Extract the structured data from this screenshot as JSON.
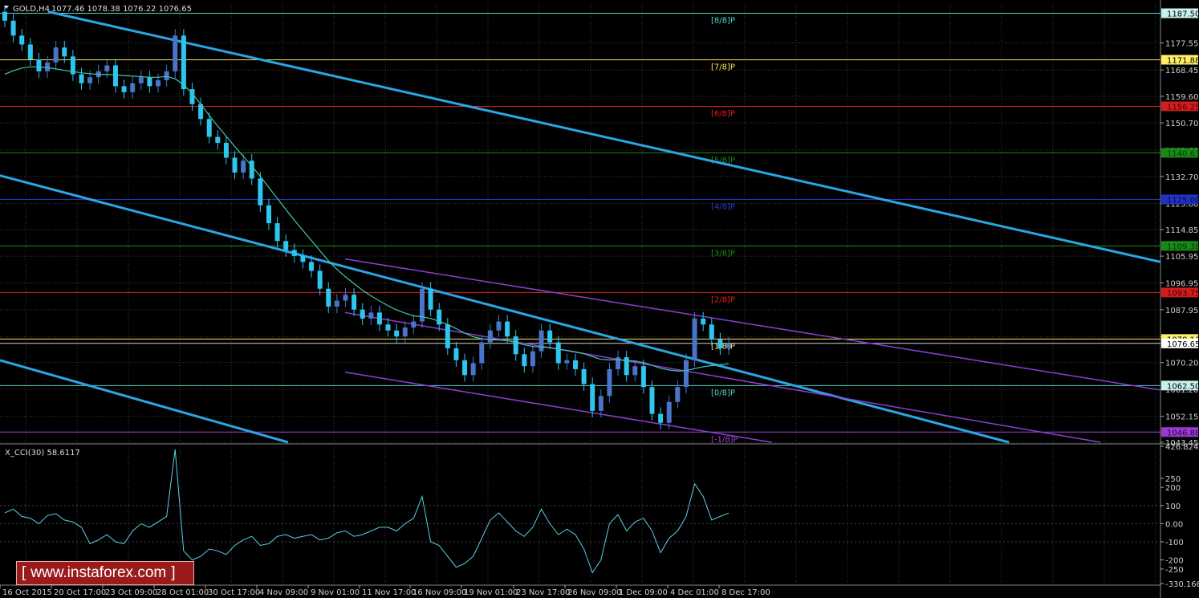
{
  "header": {
    "symbol_label": "GOLD,H4",
    "ohlc": "1077.46 1078.38 1076.22 1076.65"
  },
  "indicator": {
    "label": "X_CCI(30) 58.6117",
    "scale": {
      "max": 426.8245,
      "min": -330.1663
    },
    "ticks": [
      {
        "v": 426.8245,
        "label": "426.8245"
      },
      {
        "v": 250,
        "label": "250"
      },
      {
        "v": 200,
        "label": "200"
      },
      {
        "v": 100,
        "label": "100"
      },
      {
        "v": 0,
        "label": "0.00"
      },
      {
        "v": -100,
        "label": "-100"
      },
      {
        "v": -200,
        "label": "-200"
      },
      {
        "v": -250,
        "label": "-250"
      },
      {
        "v": -330.1663,
        "label": "-330.1663"
      }
    ]
  },
  "logo": {
    "left": "[",
    "text": "www.instaforex.com",
    "right": "]"
  },
  "colors": {
    "background": "#000000",
    "grid": "#3a3a3a",
    "up_candle": "#4a74c9",
    "down_candle": "#2ec5ee",
    "moving_average": "#3fc8b0",
    "trend_channel": "#2aa6e6",
    "regression_channel": "#8c3fd1",
    "cci_line": "#5cd0e6",
    "logo_bg": "#9b1b1b"
  },
  "chart_data": {
    "type": "line",
    "title": "GOLD,H4",
    "y_range": [
      1043.45,
      1190.6
    ],
    "y_ticks": [
      1177.55,
      1168.45,
      1159.6,
      1150.7,
      1141.6,
      1132.7,
      1123.6,
      1114.85,
      1105.95,
      1096.95,
      1087.95,
      1078.85,
      1070.2,
      1061.2,
      1052.15,
      1043.45
    ],
    "x_labels": [
      "16 Oct 2015",
      "20 Oct 17:00",
      "23 Oct 09:00",
      "28 Oct 01:00",
      "30 Oct 17:00",
      "4 Nov 09:00",
      "9 Nov 01:00",
      "11 Nov 17:00",
      "16 Nov 09:00",
      "19 Nov 01:00",
      "23 Nov 17:00",
      "26 Nov 09:00",
      "1 Dec 09:00",
      "4 Dec 01:00",
      "8 Dec 17:00"
    ],
    "murrey_levels": [
      {
        "label": "[8/8]P",
        "value": 1187.5,
        "price_tag": "1187.50",
        "color": "#4fd4c8",
        "tag_bg": "#c8f0ec",
        "tag_fg": "#000000"
      },
      {
        "label": "[7/8]P",
        "value": 1171.88,
        "price_tag": "1171.88",
        "color": "#ffe55c",
        "tag_bg": "#ffee66",
        "tag_fg": "#000000"
      },
      {
        "label": "[6/8]P",
        "value": 1156.25,
        "price_tag": "1156.25",
        "color": "#e02020",
        "tag_bg": "#d21d1d",
        "tag_fg": "#4a0000"
      },
      {
        "label": "[5/8]P",
        "value": 1140.63,
        "price_tag": "1140.63",
        "color": "#1f8a1f",
        "tag_bg": "#188a18",
        "tag_fg": "#003800"
      },
      {
        "label": "[4/8]P",
        "value": 1125.0,
        "price_tag": "1125.00",
        "color": "#2a3ccf",
        "tag_bg": "#2233c2",
        "tag_fg": "#000c50"
      },
      {
        "label": "[3/8]P",
        "value": 1109.38,
        "price_tag": "1109.38",
        "color": "#1f8a1f",
        "tag_bg": "#188a18",
        "tag_fg": "#003800"
      },
      {
        "label": "[2/8]P",
        "value": 1093.75,
        "price_tag": "1093.75",
        "color": "#e02020",
        "tag_bg": "#d21d1d",
        "tag_fg": "#4a0000"
      },
      {
        "label": "[1/8]P",
        "value": 1078.13,
        "price_tag": "1078.13",
        "color": "#ffe55c",
        "tag_bg": "#ffee66",
        "tag_fg": "#000000"
      },
      {
        "label": "[0/8]P",
        "value": 1062.5,
        "price_tag": "1062.50",
        "color": "#4fd4c8",
        "tag_bg": "#c8f0ec",
        "tag_fg": "#000000"
      },
      {
        "label": "[-1/8]P",
        "value": 1046.88,
        "price_tag": "1046.88",
        "color": "#a13fd6",
        "tag_bg": "#9a3bd0",
        "tag_fg": "#2a004a"
      }
    ],
    "current_price": 1076.65,
    "price_line_tag": "1076.65",
    "series": [
      {
        "type": "candlestick",
        "close": [
          1185,
          1180,
          1177,
          1172,
          1168,
          1171,
          1176,
          1173,
          1167,
          1164,
          1166,
          1168,
          1170,
          1163,
          1161,
          1164,
          1166,
          1163,
          1165,
          1168,
          1180,
          1162,
          1157,
          1152,
          1146,
          1144,
          1139,
          1134,
          1138,
          1132,
          1123,
          1117,
          1111,
          1108,
          1106,
          1104,
          1101,
          1095,
          1089,
          1091,
          1093,
          1088,
          1085,
          1087,
          1083,
          1081,
          1079,
          1082,
          1084,
          1095,
          1088,
          1083,
          1075,
          1071,
          1066,
          1070,
          1077,
          1081,
          1084,
          1079,
          1073,
          1069,
          1074,
          1081,
          1077,
          1070,
          1071,
          1068,
          1063,
          1054,
          1059,
          1068,
          1072,
          1066,
          1069,
          1062,
          1053,
          1050,
          1057,
          1062,
          1071,
          1085,
          1083,
          1078,
          1075,
          1076.65
        ]
      },
      {
        "type": "moving_average",
        "values": [
          1167,
          1168.2,
          1169.1,
          1169.5,
          1169.5,
          1169.2,
          1168.8,
          1168.3,
          1167.9,
          1167.5,
          1167.2,
          1167.0,
          1166.9,
          1166.8,
          1166.6,
          1166.4,
          1166.2,
          1166.0,
          1166.0,
          1166.3,
          1165.5,
          1163.5,
          1160.5,
          1157.0,
          1153.2,
          1149.6,
          1146.2,
          1142.8,
          1139.5,
          1136.2,
          1132.7,
          1129.0,
          1125.3,
          1121.6,
          1118.0,
          1114.6,
          1111.2,
          1107.8,
          1104.4,
          1101.5,
          1099.0,
          1096.7,
          1094.5,
          1092.6,
          1090.9,
          1089.3,
          1087.9,
          1086.8,
          1085.9,
          1085.6,
          1085.0,
          1084.1,
          1083.0,
          1081.6,
          1080.1,
          1078.9,
          1078.2,
          1077.9,
          1077.8,
          1077.6,
          1077.0,
          1076.2,
          1075.6,
          1075.4,
          1075.2,
          1074.7,
          1074.3,
          1073.8,
          1073.2,
          1072.2,
          1071.3,
          1071.1,
          1071.2,
          1070.9,
          1070.7,
          1070.2,
          1069.3,
          1068.3,
          1067.7,
          1067.4,
          1067.5,
          1068.2,
          1068.8,
          1069.2,
          1069.5,
          1069.8
        ]
      },
      {
        "type": "cci",
        "name": "X_CCI(30)",
        "values": [
          60,
          80,
          40,
          30,
          0,
          45,
          55,
          20,
          10,
          -20,
          -110,
          -90,
          -60,
          -100,
          -110,
          -40,
          0,
          -20,
          10,
          40,
          410,
          -150,
          -200,
          -180,
          -140,
          -150,
          -170,
          -120,
          -90,
          -70,
          -120,
          -110,
          -70,
          -60,
          -80,
          -70,
          -60,
          -90,
          -80,
          -50,
          -40,
          -70,
          -60,
          -40,
          -20,
          -20,
          -40,
          0,
          30,
          150,
          -100,
          -120,
          -180,
          -240,
          -220,
          -180,
          -80,
          20,
          60,
          10,
          -40,
          -70,
          -20,
          80,
          0,
          -60,
          -30,
          -60,
          -140,
          -270,
          -200,
          0,
          50,
          -40,
          10,
          30,
          -40,
          -160,
          -80,
          -40,
          40,
          220,
          150,
          20,
          40,
          58.6117
        ]
      }
    ]
  }
}
